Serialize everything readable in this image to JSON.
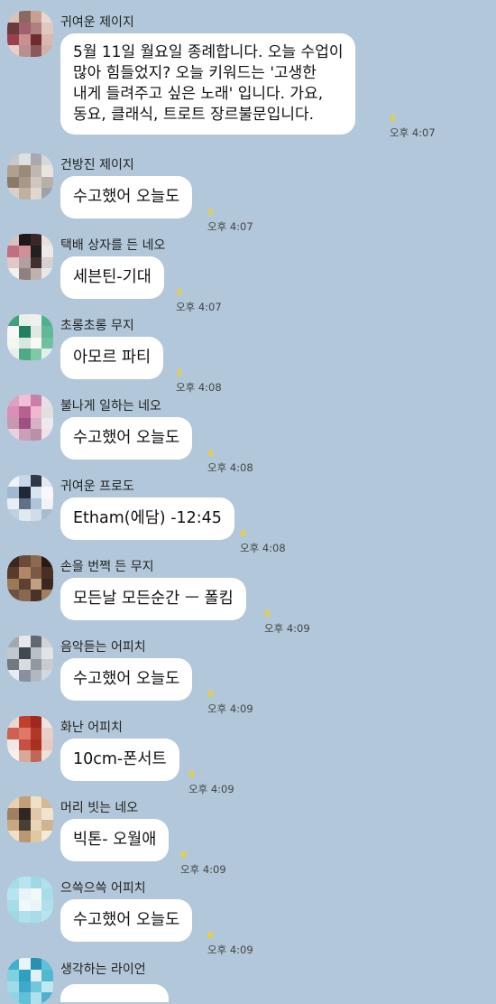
{
  "messages": [
    {
      "sender": "귀여운 제이지",
      "text": "5월 11일 월요일 종례합니다. 오늘 수업이\n많아 힘들었지? 오늘 키워드는 '고생한\n내게 들려주고 싶은 노래' 입니다. 가요,\n동요, 클래식, 트로트 장르불문입니다.",
      "unread": "2",
      "time": "오후 4:07"
    },
    {
      "sender": "건방진 제이지",
      "text": "수고했어 오늘도",
      "unread": "2",
      "time": "오후 4:07"
    },
    {
      "sender": "택배 상자를 든 네오",
      "text": "세븐틴-기대",
      "unread": "3",
      "time": "오후 4:07"
    },
    {
      "sender": "초롱초롱 무지",
      "text": "아모르 파티",
      "unread": "3",
      "time": "오후 4:08"
    },
    {
      "sender": "불나게 일하는 네오",
      "text": "수고했어 오늘도",
      "unread": "4",
      "time": "오후 4:08"
    },
    {
      "sender": "귀여운 프로도",
      "text": "Etham(에담) -12:45",
      "unread": "4",
      "time": "오후 4:08"
    },
    {
      "sender": "손을 번쩍 든 무지",
      "text": "모든날 모든순간 ㅡ 폴킴",
      "unread": "5",
      "time": "오후 4:09"
    },
    {
      "sender": "음악듣는 어피치",
      "text": "수고했어 오늘도",
      "unread": "5",
      "time": "오후 4:09"
    },
    {
      "sender": "화난 어피치",
      "text": "10cm-폰서트",
      "unread": "5",
      "time": "오후 4:09"
    },
    {
      "sender": "머리 빗는 네오",
      "text": "빅톤- 오월애",
      "unread": "6",
      "time": "오후 4:09"
    },
    {
      "sender": "으쓱으쓱 어피치",
      "text": "수고했어 오늘도",
      "unread": "6",
      "time": "오후 4:09"
    },
    {
      "sender": "생각하는 라이언"
    }
  ],
  "colors": {
    "background": "#b2c7d9",
    "bubble": "#ffffff",
    "unread": "#f2d21a"
  }
}
